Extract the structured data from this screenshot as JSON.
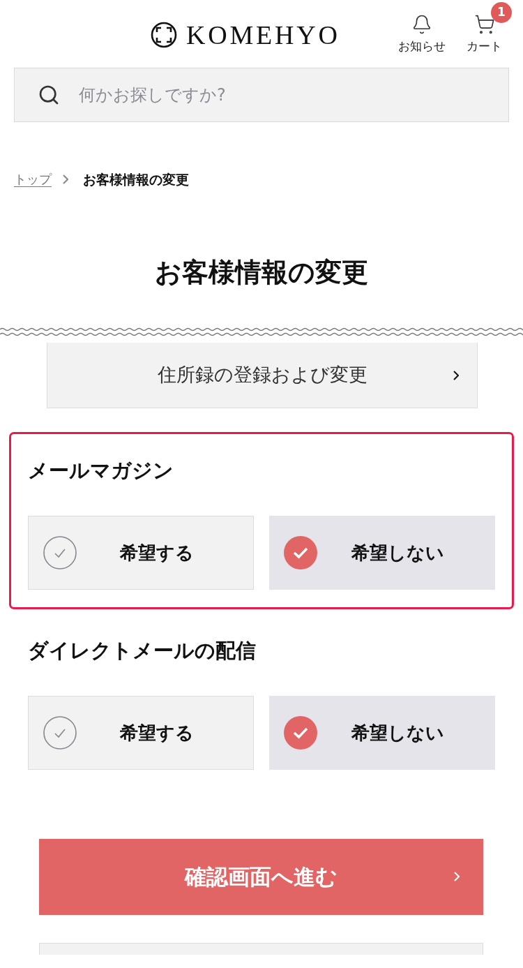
{
  "header": {
    "logo": "KOMEHYO",
    "actions": [
      {
        "kind": "bell",
        "label": "お知らせ"
      },
      {
        "kind": "cart",
        "label": "カート",
        "badge": "1"
      }
    ]
  },
  "search": {
    "placeholder": "何かお探しですか?"
  },
  "breadcrumb": [
    {
      "label": "トップ",
      "current": false
    },
    {
      "label": "お客様情報の変更",
      "current": true
    }
  ],
  "title": "お客様情報の変更",
  "address_link": {
    "label": "住所録の登録および変更"
  },
  "sections": [
    {
      "title": "メールマガジン",
      "highlighted": true,
      "options": [
        {
          "label": "希望する",
          "selected": false
        },
        {
          "label": "希望しない",
          "selected": true
        }
      ]
    },
    {
      "title": "ダイレクトメールの配信",
      "highlighted": false,
      "options": [
        {
          "label": "希望する",
          "selected": false
        },
        {
          "label": "希望しない",
          "selected": true
        }
      ]
    }
  ],
  "confirm_button": {
    "label": "確認画面へ進む"
  }
}
